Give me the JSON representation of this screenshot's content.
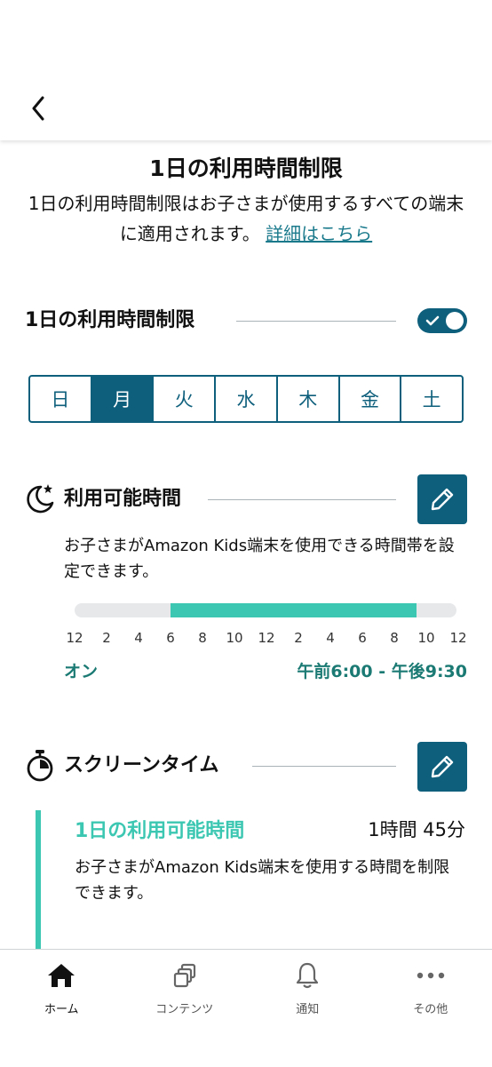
{
  "header": {
    "back_icon": "chevron-left-icon"
  },
  "page": {
    "title": "1日の利用時間制限",
    "intro_text": "1日の利用時間制限はお子さまが使用するすべての端末に適用されます。",
    "intro_link": "詳細はこちら"
  },
  "daily_limit": {
    "title": "1日の利用時間制限",
    "toggle_on": true,
    "days": [
      "日",
      "月",
      "火",
      "水",
      "木",
      "金",
      "土"
    ],
    "selected_day": "月"
  },
  "available_time": {
    "icon": "moon-star-icon",
    "title": "利用可能時間",
    "edit_icon": "pencil-icon",
    "description": "お子さまがAmazon Kids端末を使用できる時間帯を設定できます。",
    "timeline_ticks": [
      "12",
      "2",
      "4",
      "6",
      "8",
      "10",
      "12",
      "2",
      "4",
      "6",
      "8",
      "10",
      "12"
    ],
    "range_start_hour": 6,
    "range_end_hour": 21.5,
    "status": "オン",
    "range_text": "午前6:00 - 午後9:30"
  },
  "screen_time": {
    "icon": "stopwatch-icon",
    "title": "スクリーンタイム",
    "edit_icon": "pencil-icon",
    "limit_title": "1日の利用可能時間",
    "limit_value": "1時間 45分",
    "description": "お子さまがAmazon Kids端末を使用する時間を制限できます。"
  },
  "bottom_nav": [
    {
      "label": "ホーム",
      "icon": "home-icon",
      "active": true
    },
    {
      "label": "コンテンツ",
      "icon": "content-icon",
      "active": false
    },
    {
      "label": "通知",
      "icon": "bell-icon",
      "active": false
    },
    {
      "label": "その他",
      "icon": "more-icon",
      "active": false
    }
  ],
  "colors": {
    "primary": "#0e5f7c",
    "accent": "#3cc7b2",
    "status_text": "#1b7a73"
  }
}
